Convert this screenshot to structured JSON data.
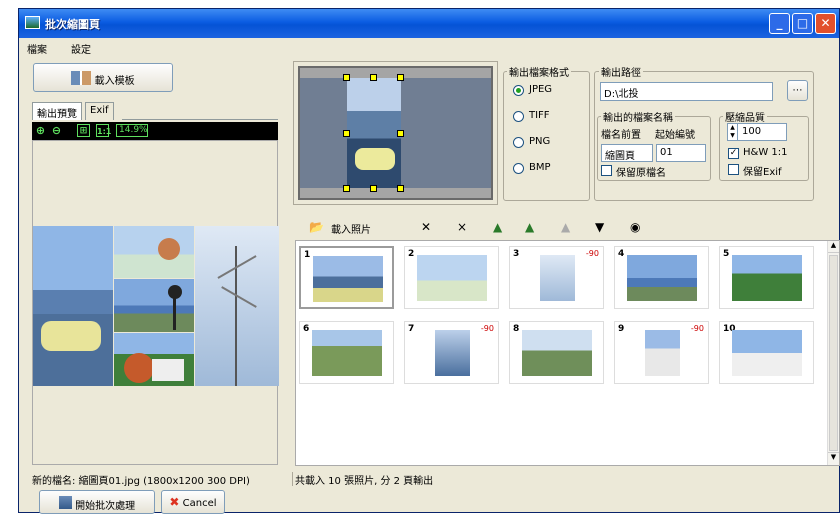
{
  "window": {
    "title": "批次縮圖頁"
  },
  "menu": [
    "檔案",
    "設定"
  ],
  "left": {
    "load_template": "載入模板",
    "tabs": [
      "輸出預覽",
      "Exif"
    ],
    "zoom": "14.9%",
    "status": "新的檔名: 縮圖頁01.jpg (1800x1200 300 DPI)"
  },
  "output": {
    "format_group": "輸出檔案格式",
    "formats": [
      "JPEG",
      "TIFF",
      "PNG",
      "BMP"
    ],
    "selected_format": "JPEG",
    "path_group": "輸出路徑",
    "path_value": "D:\\北投",
    "name_group": "輸出的檔案名稱",
    "prefix_label": "檔名前置",
    "start_label": "起始編號",
    "prefix_value": "縮圖頁",
    "start_value": "01",
    "keep_name_label": "保留原檔名",
    "quality_group": "壓縮品質",
    "quality_value": "100",
    "hw_label": "H&W 1:1",
    "keep_exif_label": "保留Exif"
  },
  "toolbar": {
    "load_photos": "載入照片"
  },
  "thumbs": [
    {
      "num": "1",
      "rot": ""
    },
    {
      "num": "2",
      "rot": ""
    },
    {
      "num": "3",
      "rot": "-90"
    },
    {
      "num": "4",
      "rot": ""
    },
    {
      "num": "5",
      "rot": ""
    },
    {
      "num": "6",
      "rot": ""
    },
    {
      "num": "7",
      "rot": "-90"
    },
    {
      "num": "8",
      "rot": ""
    },
    {
      "num": "9",
      "rot": "-90"
    },
    {
      "num": "10",
      "rot": ""
    }
  ],
  "status_right": "共載入 10 張照片, 分 2 頁輸出",
  "footer": {
    "start": "開始批次處理",
    "cancel": "Cancel"
  },
  "colors": {
    "title_blue": "#0553d6",
    "accent_green": "#5fe05f",
    "rotation_red": "#cc0000"
  }
}
